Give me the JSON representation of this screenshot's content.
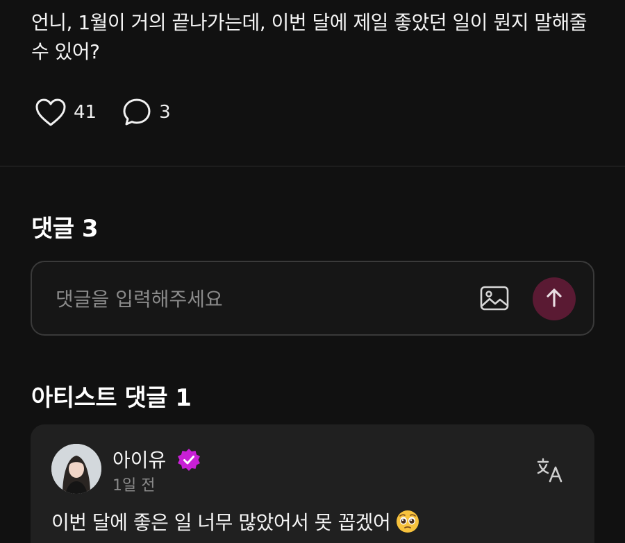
{
  "post": {
    "text": "언니, 1월이 거의 끝나가는데, 이번 달에 제일 좋았던 일이 뭔지 말해줄 수 있어?",
    "likes": "41",
    "comments": "3",
    "like_icon": "heart-outline-icon",
    "comment_icon": "speech-bubble-icon"
  },
  "comments_section": {
    "title": "댓글 3",
    "input_placeholder": "댓글을 입력해주세요",
    "image_icon": "image-icon",
    "send_icon": "arrow-up-icon",
    "send_color": "#5a1a33"
  },
  "artist_section": {
    "title": "아티스트 댓글 1",
    "comment": {
      "author": "아이유",
      "verified_color": "#c81fd6",
      "time": "1일 전",
      "text": "이번 달에 좋은 일 너무 많았어서 못 꼽겠어",
      "emoji": "pleading-face-emoji",
      "translate_icon": "translate-icon"
    }
  }
}
